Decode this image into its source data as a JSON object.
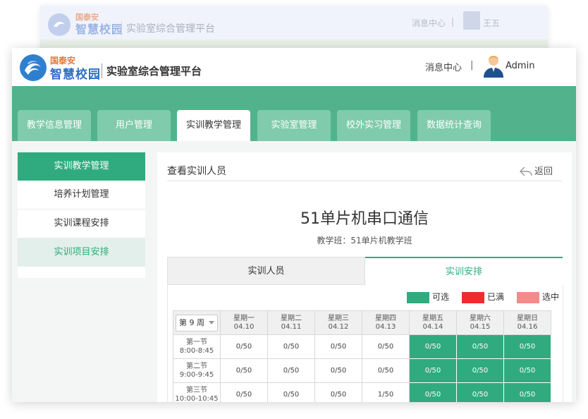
{
  "ghost": {
    "brand_small": "国泰安",
    "brand_big": "智慧校园",
    "title": "实验室综合管理平台",
    "message_center": "消息中心",
    "separator": "|",
    "user": "王五"
  },
  "header": {
    "brand_small": "国泰安",
    "brand_big": "智慧校园",
    "title": "实验室综合管理平台",
    "message_center": "消息中心",
    "separator": "|",
    "user": "Admin"
  },
  "nav": {
    "tabs": [
      "教学信息管理",
      "用户管理",
      "实训教学管理",
      "实验室管理",
      "校外实习管理",
      "数据统计查询"
    ],
    "active": "实训教学管理"
  },
  "sidebar": {
    "header": "实训教学管理",
    "items": [
      "培养计划管理",
      "实训课程安排",
      "实训项目安排"
    ],
    "selected": "实训项目安排"
  },
  "content": {
    "title": "查看实训人员",
    "back_label": "返回",
    "course_name": "51单片机串口通信",
    "class_label": "教学班：51单片机教学班",
    "tabs": [
      "实训人员",
      "实训安排"
    ],
    "active_tab": "实训安排"
  },
  "legend": [
    {
      "label": "可选",
      "color": "#2fab7f"
    },
    {
      "label": "已满",
      "color": "#ee2c2c"
    },
    {
      "label": "选中",
      "color": "#f58a8a"
    }
  ],
  "schedule": {
    "week_select": "第 9 周",
    "days": [
      {
        "name": "星期一",
        "date": "04.10"
      },
      {
        "name": "星期二",
        "date": "04.11"
      },
      {
        "name": "星期三",
        "date": "04.12"
      },
      {
        "name": "星期四",
        "date": "04.13"
      },
      {
        "name": "星期五",
        "date": "04.14"
      },
      {
        "name": "星期六",
        "date": "04.15"
      },
      {
        "name": "星期日",
        "date": "04.16"
      }
    ],
    "rows": [
      {
        "slot": "第一节",
        "time": "8:00-8:45",
        "cells": [
          "0/50",
          "0/50",
          "0/50",
          "0/50",
          "0/50",
          "0/50",
          "0/50"
        ]
      },
      {
        "slot": "第二节",
        "time": "9:00-9:45",
        "cells": [
          "0/50",
          "0/50",
          "0/50",
          "0/50",
          "0/50",
          "0/50",
          "0/50"
        ]
      },
      {
        "slot": "第三节",
        "time": "10:00-10:45",
        "cells": [
          "0/50",
          "0/50",
          "0/50",
          "1/50",
          "0/50",
          "0/50",
          "0/50"
        ]
      }
    ],
    "available_days": [
      4,
      5,
      6
    ]
  }
}
